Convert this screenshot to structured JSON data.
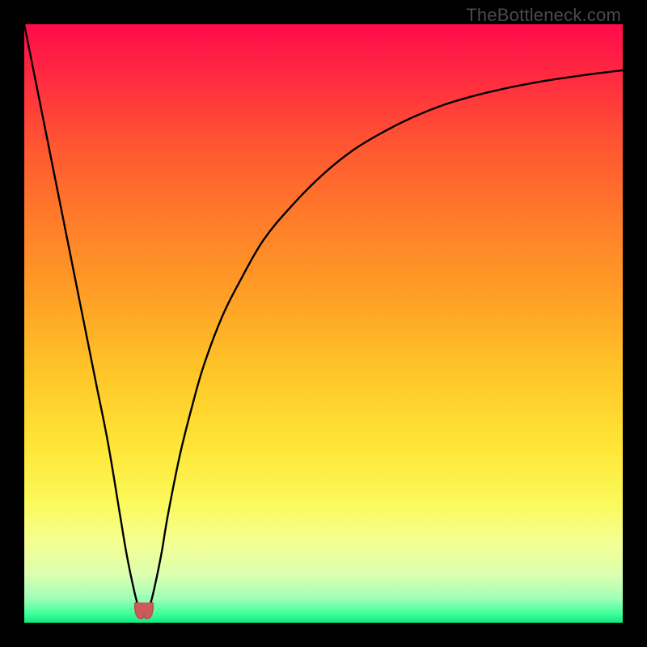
{
  "watermark": "TheBottleneck.com",
  "colors": {
    "frame": "#000000",
    "curve": "#000000",
    "marker_fill": "#cc5a5a",
    "marker_stroke": "#b94e4e"
  },
  "chart_data": {
    "type": "line",
    "title": "",
    "xlabel": "",
    "ylabel": "",
    "xlim": [
      0,
      100
    ],
    "ylim": [
      0,
      100
    ],
    "grid": false,
    "legend": false,
    "annotations": [
      "TheBottleneck.com"
    ],
    "marker": {
      "x": 20,
      "y": 2
    },
    "series": [
      {
        "name": "bottleneck-curve",
        "x": [
          0,
          2,
          4,
          6,
          8,
          10,
          12,
          14,
          16,
          17,
          18,
          19,
          20,
          21,
          22,
          23,
          24,
          26,
          28,
          30,
          33,
          36,
          40,
          45,
          50,
          55,
          60,
          65,
          70,
          75,
          80,
          85,
          90,
          95,
          100
        ],
        "y": [
          100,
          90,
          80,
          70,
          60,
          50,
          40,
          30,
          18,
          12,
          7,
          3,
          2,
          3,
          7,
          12,
          18,
          28,
          36,
          43,
          51,
          57,
          64,
          70,
          75,
          79,
          82,
          84.5,
          86.5,
          88,
          89.2,
          90.2,
          91,
          91.7,
          92.3
        ]
      }
    ]
  }
}
